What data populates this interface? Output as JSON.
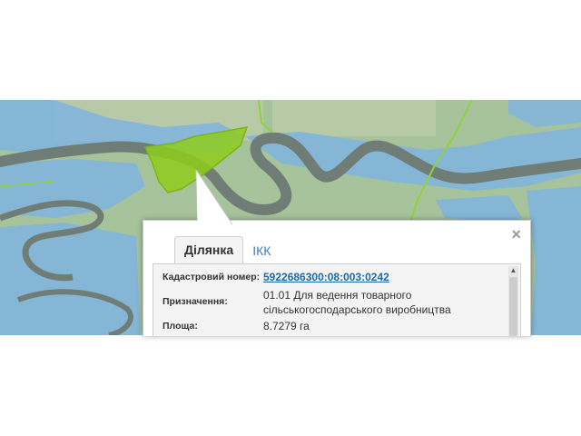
{
  "popup": {
    "close_label": "×",
    "tabs": [
      {
        "label": "Ділянка",
        "active": true
      },
      {
        "label": "ІКК",
        "active": false
      }
    ],
    "fields": {
      "cadastral_label": "Кадастровий номер:",
      "cadastral_value": "5922686300:08:003:0242",
      "purpose_label": "Призначення:",
      "purpose_line1": "01.01 Для ведення товарного",
      "purpose_line2": "сільськогосподарського виробництва",
      "area_label": "Площа:",
      "area_value": "8.7279 га"
    }
  },
  "colors": {
    "water": "#7fb4e0",
    "river": "#6f7d76",
    "parcel": "#8fcc1c",
    "boundary": "#8fd23a",
    "land": "#a9c6a0",
    "link": "#1a6aa8",
    "tab_inactive": "#3a7fc2"
  }
}
